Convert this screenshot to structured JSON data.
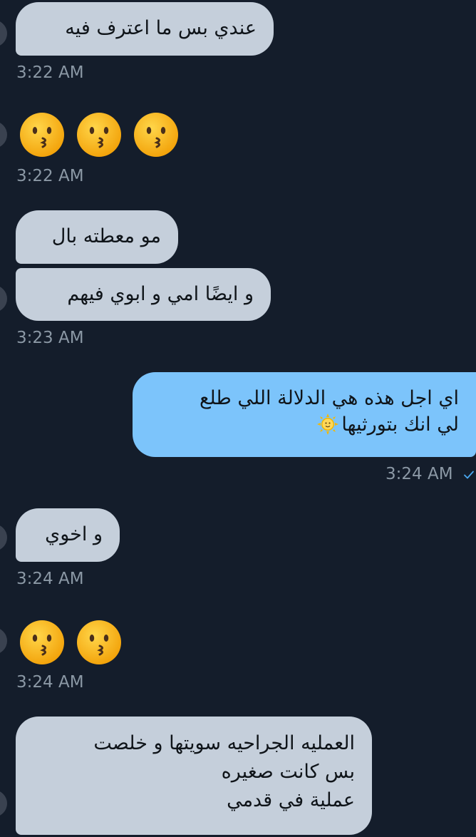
{
  "messages": [
    {
      "id": "m1",
      "direction": "incoming",
      "lines": [
        "عندي بس ما اعترف فيه"
      ]
    },
    {
      "id": "t1",
      "time": "3:22 AM"
    },
    {
      "id": "m2",
      "direction": "incoming",
      "kind": "emoji",
      "emoji_name": "kissing-face-icon",
      "count": 3
    },
    {
      "id": "t2",
      "time": "3:22 AM"
    },
    {
      "id": "m3",
      "direction": "incoming",
      "lines": [
        "مو معطته بال"
      ]
    },
    {
      "id": "m4",
      "direction": "incoming",
      "lines": [
        "و ايضًا امي و ابوي فيهم"
      ]
    },
    {
      "id": "t3",
      "time": "3:23 AM"
    },
    {
      "id": "m5",
      "direction": "outgoing",
      "lines": [
        "اي اجل هذه هي الدلالة اللي طلع",
        "لي انك بتورثيها"
      ],
      "inline_emoji": "sun-with-face-icon"
    },
    {
      "id": "t4",
      "time": "3:24 AM",
      "receipt": "checkmark-icon"
    },
    {
      "id": "m6",
      "direction": "incoming",
      "lines": [
        "و اخوي"
      ]
    },
    {
      "id": "t5",
      "time": "3:24 AM"
    },
    {
      "id": "m7",
      "direction": "incoming",
      "kind": "emoji",
      "emoji_name": "kissing-face-icon",
      "count": 2
    },
    {
      "id": "t6",
      "time": "3:24 AM"
    },
    {
      "id": "m8",
      "direction": "incoming",
      "lines": [
        "العمليه الجراحيه سويتها و خلصت",
        "بس كانت صغيره",
        "عملية في قدمي"
      ]
    }
  ],
  "colors": {
    "background": "#141d2b",
    "incoming_bubble": "#c5cfdb",
    "outgoing_bubble": "#7cc4fb",
    "timestamp": "#8b98a5",
    "read_receipt": "#4aa8f0"
  }
}
